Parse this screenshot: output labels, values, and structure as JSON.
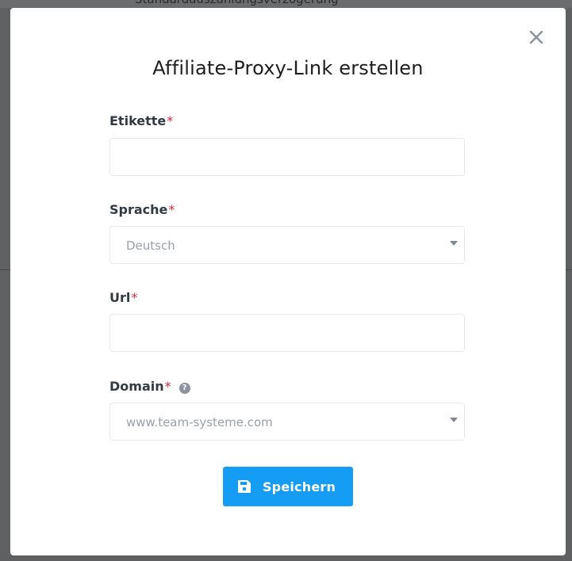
{
  "background": {
    "partial_text": "Standardauszahlungsverzögerung"
  },
  "modal": {
    "title": "Affiliate-Proxy-Link erstellen",
    "close_icon": "close-icon",
    "required_marker": "*",
    "fields": {
      "label": {
        "label": "Etikette",
        "value": ""
      },
      "language": {
        "label": "Sprache",
        "value": "Deutsch"
      },
      "url": {
        "label": "Url",
        "value": ""
      },
      "domain": {
        "label": "Domain",
        "value": "www.team-systeme.com",
        "help_icon": "question-circle-icon"
      }
    },
    "save_button": {
      "label": "Speichern",
      "icon": "floppy-disk-icon"
    }
  },
  "colors": {
    "accent": "#149df2",
    "required": "#e0243c",
    "backdrop": "#5f6061"
  }
}
